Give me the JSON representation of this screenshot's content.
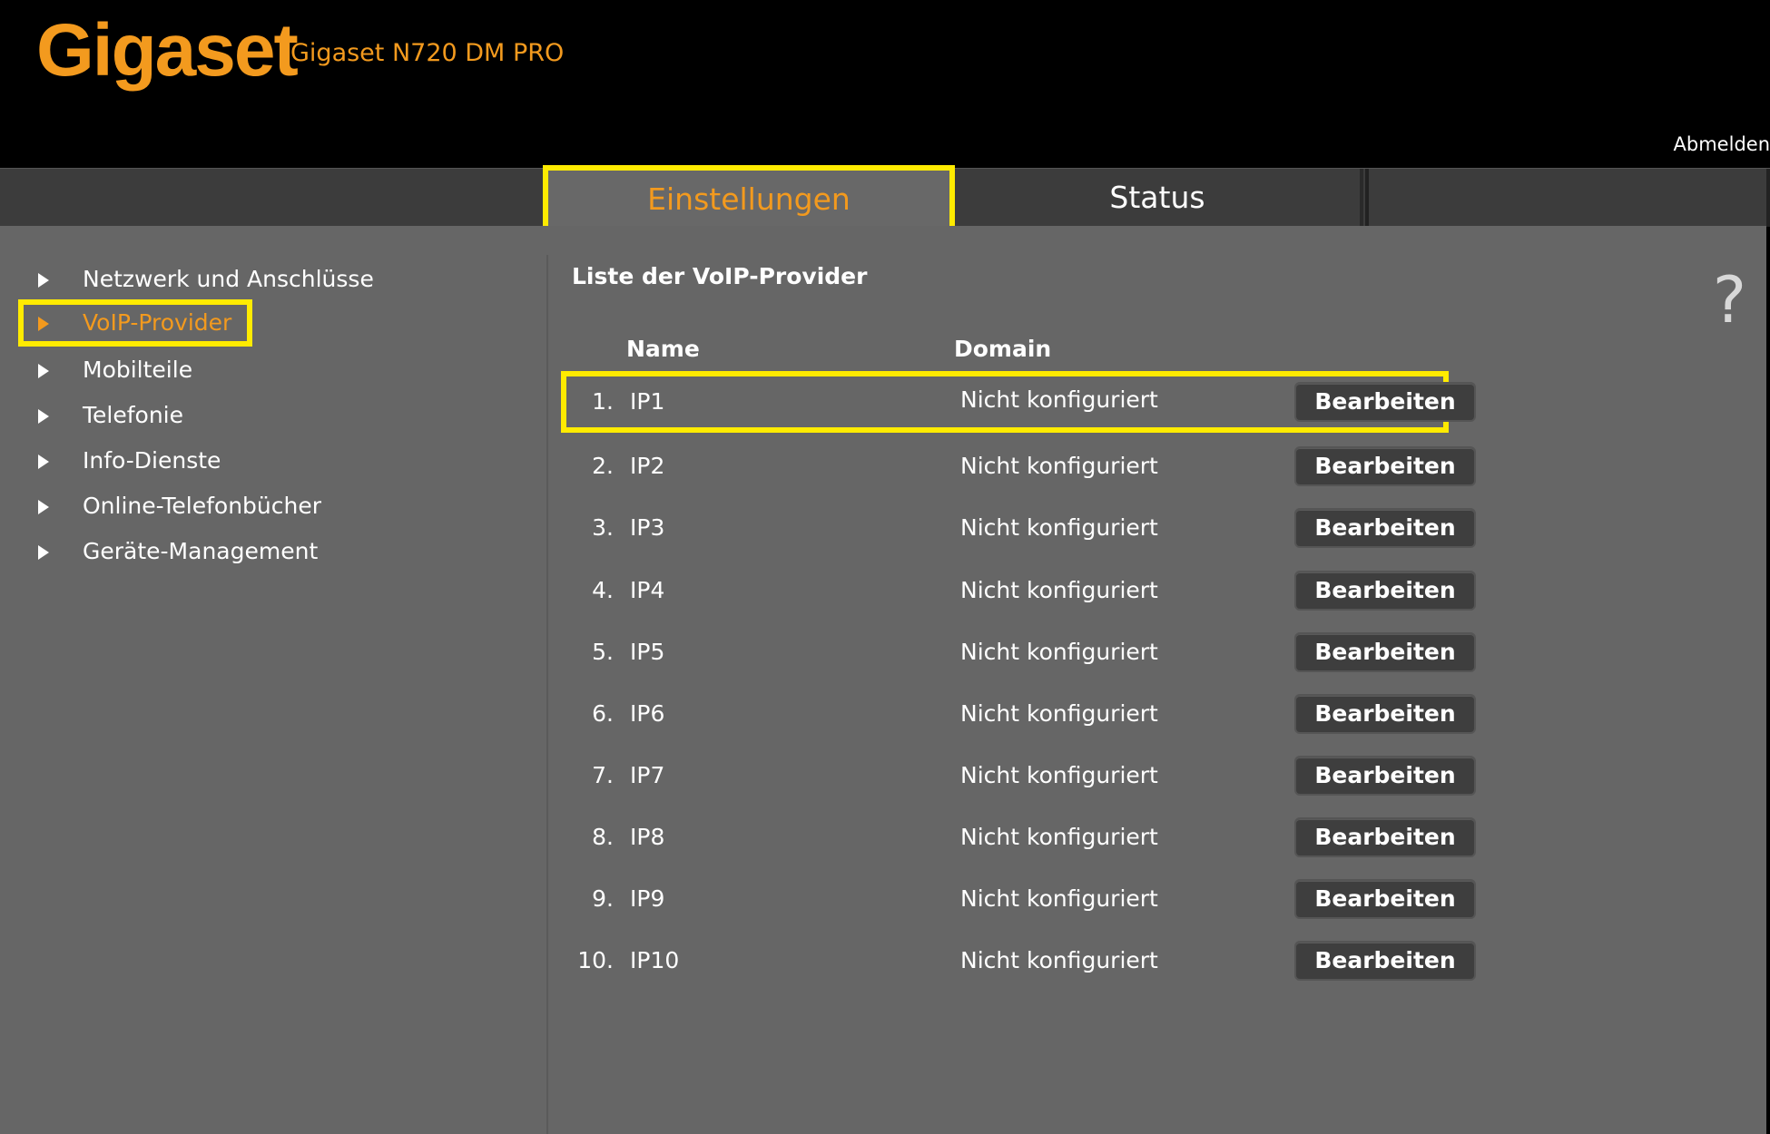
{
  "header": {
    "logo_text": "Gigaset",
    "device_name": "Gigaset N720 DM PRO",
    "logout_label": "Abmelden",
    "accent_color": "#f39a1e"
  },
  "tabs": [
    {
      "label": "Einstellungen",
      "active": true
    },
    {
      "label": "Status",
      "active": false
    }
  ],
  "sidebar": {
    "items": [
      {
        "label": "Netzwerk und Anschlüsse",
        "active": false
      },
      {
        "label": "VoIP-Provider",
        "active": true
      },
      {
        "label": "Mobilteile",
        "active": false
      },
      {
        "label": "Telefonie",
        "active": false
      },
      {
        "label": "Info-Dienste",
        "active": false
      },
      {
        "label": "Online-Telefonbücher",
        "active": false
      },
      {
        "label": "Geräte-Management",
        "active": false
      }
    ]
  },
  "main": {
    "title": "Liste der VoIP-Provider",
    "help_icon": "?",
    "columns": {
      "name": "Name",
      "domain": "Domain"
    },
    "edit_label": "Bearbeiten",
    "providers": [
      {
        "num": "1.",
        "name": "IP1",
        "domain": "Nicht konfiguriert"
      },
      {
        "num": "2.",
        "name": "IP2",
        "domain": "Nicht konfiguriert"
      },
      {
        "num": "3.",
        "name": "IP3",
        "domain": "Nicht konfiguriert"
      },
      {
        "num": "4.",
        "name": "IP4",
        "domain": "Nicht konfiguriert"
      },
      {
        "num": "5.",
        "name": "IP5",
        "domain": "Nicht konfiguriert"
      },
      {
        "num": "6.",
        "name": "IP6",
        "domain": "Nicht konfiguriert"
      },
      {
        "num": "7.",
        "name": "IP7",
        "domain": "Nicht konfiguriert"
      },
      {
        "num": "8.",
        "name": "IP8",
        "domain": "Nicht konfiguriert"
      },
      {
        "num": "9.",
        "name": "IP9",
        "domain": "Nicht konfiguriert"
      },
      {
        "num": "10.",
        "name": "IP10",
        "domain": "Nicht konfiguriert"
      }
    ]
  }
}
